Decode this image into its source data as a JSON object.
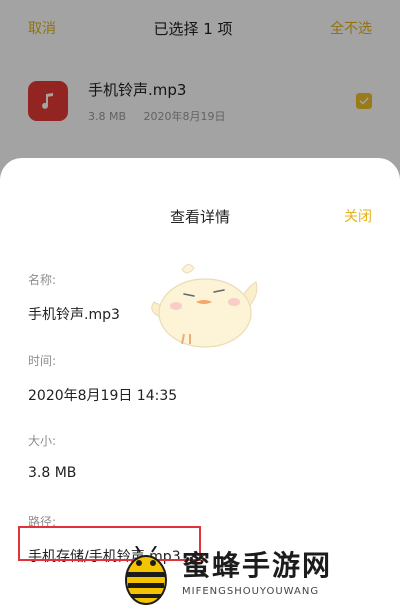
{
  "topbar": {
    "cancel_label": "取消",
    "title": "已选择 1 项",
    "deselect_all_label": "全不选"
  },
  "file": {
    "name": "手机铃声.mp3",
    "size": "3.8 MB",
    "date": "2020年8月19日",
    "icon": "music-note-icon",
    "selected": true
  },
  "details_sheet": {
    "title": "查看详情",
    "close_label": "关闭",
    "name_label": "名称:",
    "name_value": "手机铃声.mp3",
    "time_label": "时间:",
    "time_value": "2020年8月19日 14:35",
    "size_label": "大小:",
    "size_value": "3.8 MB",
    "path_label": "路径:",
    "path_value": "手机存储/手机铃声.mp3"
  },
  "watermark": {
    "title": "蜜蜂手游网",
    "subtitle": "MIFENGSHOUYOUWANG"
  },
  "colors": {
    "accent": "#e3b31a",
    "file_icon_bg": "#e53935",
    "highlight_border": "#e0333b"
  }
}
